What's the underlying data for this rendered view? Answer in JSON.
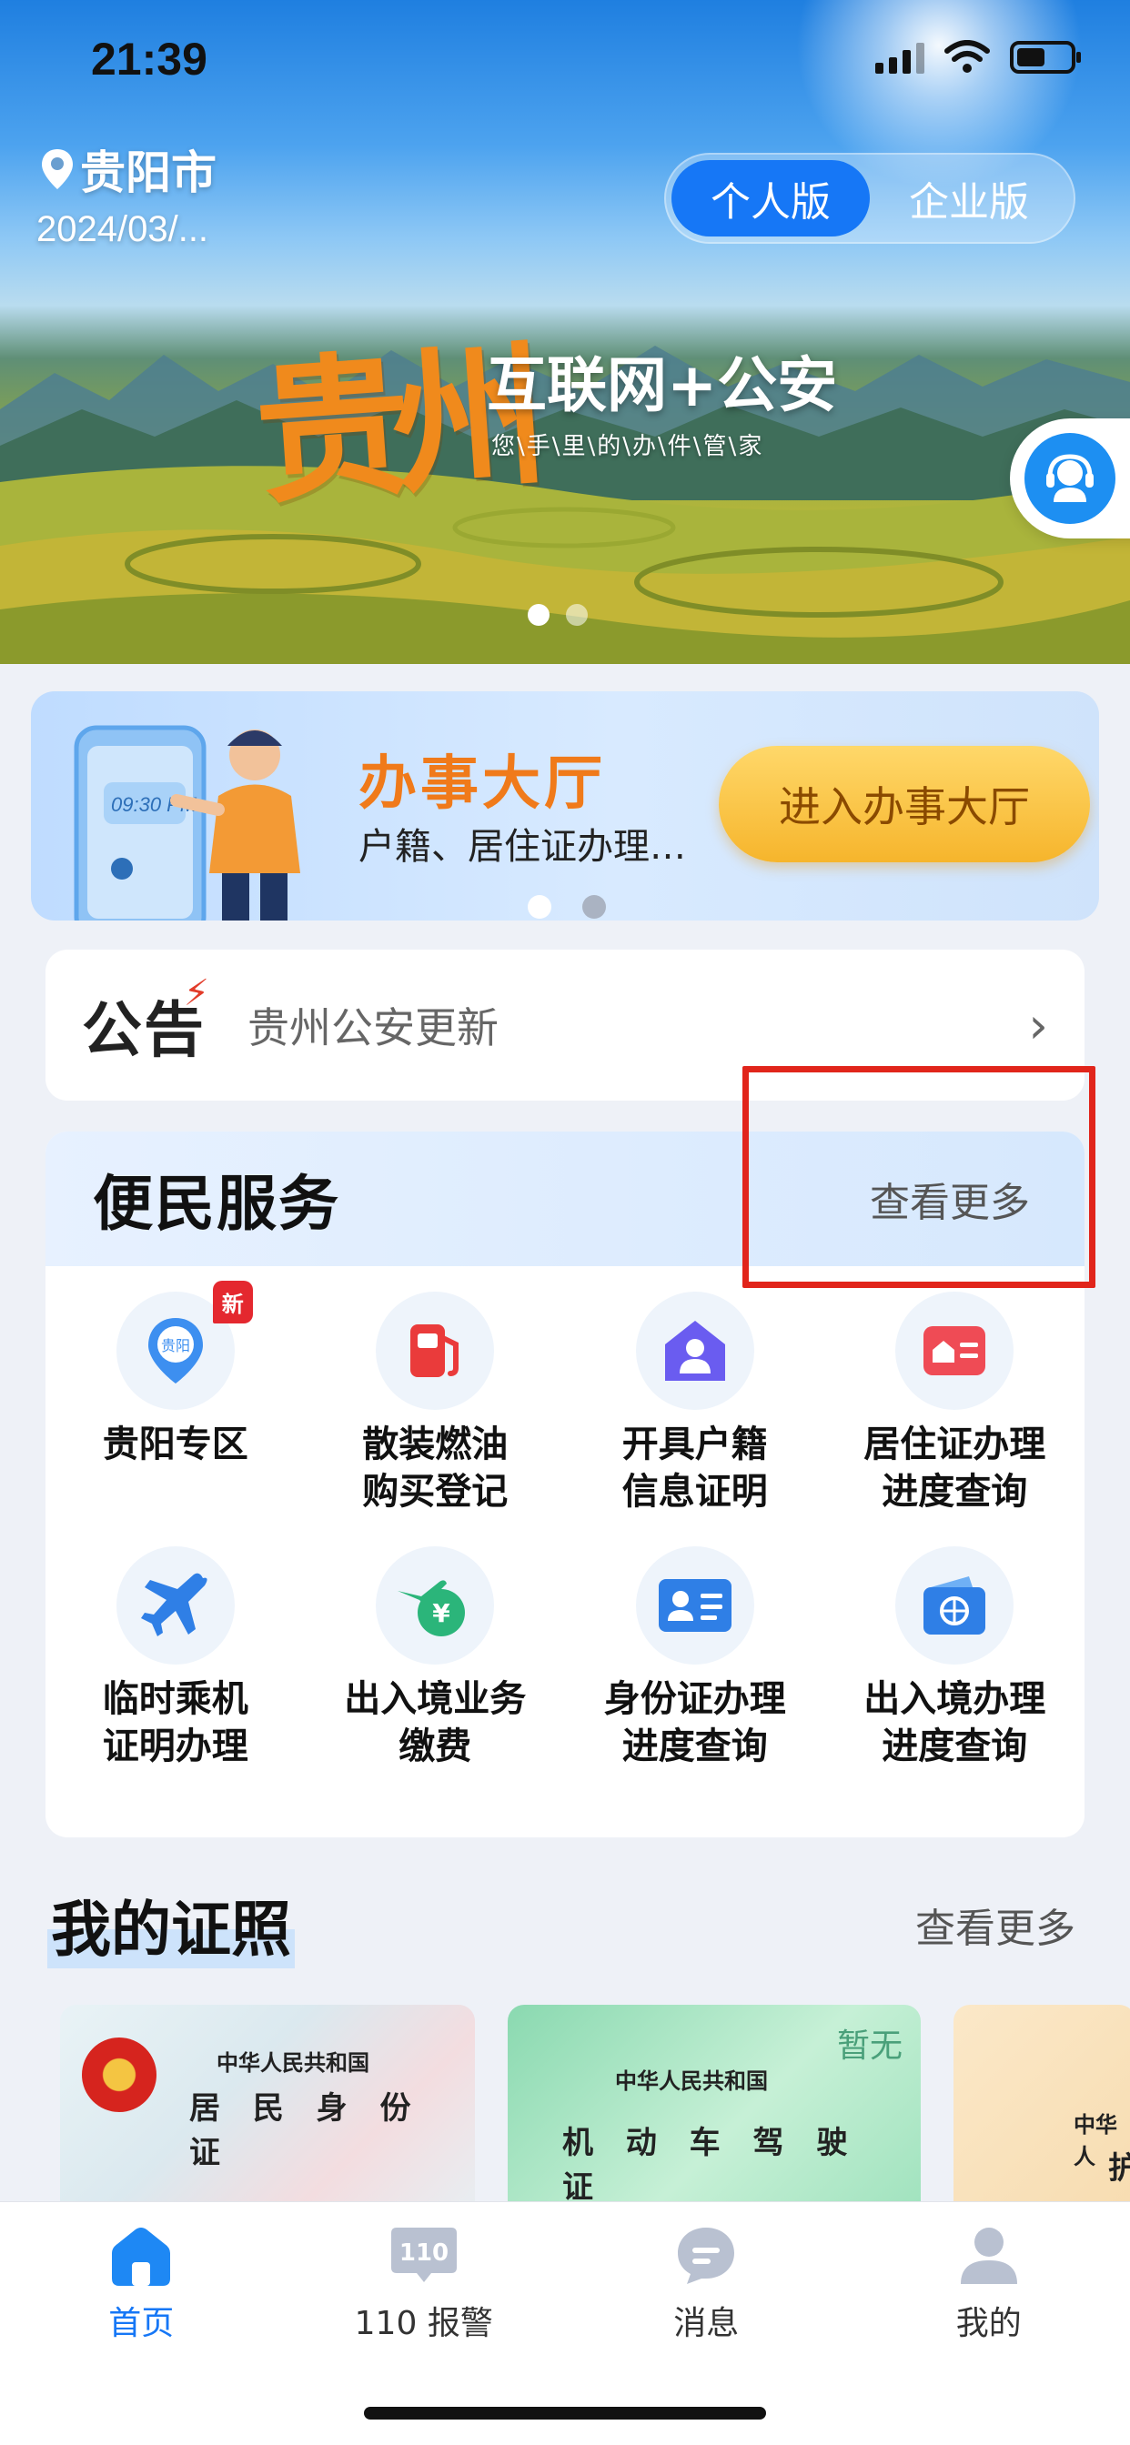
{
  "status_bar": {
    "time": "21:39"
  },
  "header": {
    "city": "贵阳市",
    "date": "2024/03/...",
    "version_toggle": [
      "个人版",
      "企业版"
    ],
    "active_version": "个人版"
  },
  "banner": {
    "brand_logo_text": "贵州",
    "title": "互联网+公安",
    "subtitle": "您\\手\\里\\的\\办\\件\\管\\家",
    "slides": 2,
    "active_slide": 1
  },
  "service_hall": {
    "title": "办事大厅",
    "subtitle": "户籍、居住证办理…",
    "enter_button": "进入办事大厅",
    "illustration_time": "09:30 PM"
  },
  "notice": {
    "tag": "公告",
    "text": "贵州公安更新",
    "chevron": "›"
  },
  "convenience": {
    "title": "便民服务",
    "more": "查看更多",
    "new_badge": "新",
    "items": [
      {
        "label": "贵阳专区",
        "icon": "location-pin-icon",
        "icon_text": "贵阳",
        "badge": true
      },
      {
        "label": "散装燃油\n购买登记",
        "icon": "fuel-pump-icon"
      },
      {
        "label": "开具户籍\n信息证明",
        "icon": "household-icon"
      },
      {
        "label": "居住证办理\n进度查询",
        "icon": "residence-permit-icon"
      },
      {
        "label": "临时乘机\n证明办理",
        "icon": "airplane-icon"
      },
      {
        "label": "出入境业务\n缴费",
        "icon": "plane-yuan-icon"
      },
      {
        "label": "身份证办理\n进度查询",
        "icon": "id-card-icon"
      },
      {
        "label": "出入境办理\n进度查询",
        "icon": "passport-icon"
      }
    ]
  },
  "licenses": {
    "title": "我的证照",
    "more": "查看更多",
    "cards": [
      {
        "line1": "中华人民共和国",
        "line2": "居 民 身 份 证"
      },
      {
        "line1": "中华人民共和国",
        "line2": "机 动 车 驾 驶 证",
        "status": "暂无"
      },
      {
        "line1": "中华人",
        "line2": "护"
      }
    ]
  },
  "tabbar": {
    "items": [
      {
        "label": "首页",
        "icon": "home-icon",
        "active": true
      },
      {
        "label": "110 报警",
        "icon": "police-110-icon",
        "icon_text": "110"
      },
      {
        "label": "消息",
        "icon": "message-icon"
      },
      {
        "label": "我的",
        "icon": "profile-icon"
      }
    ]
  },
  "colors": {
    "primary": "#1677f6",
    "accent_orange": "#f07a1a",
    "highlight_red": "#e1251b",
    "button_yellow": "#f6b52c"
  }
}
